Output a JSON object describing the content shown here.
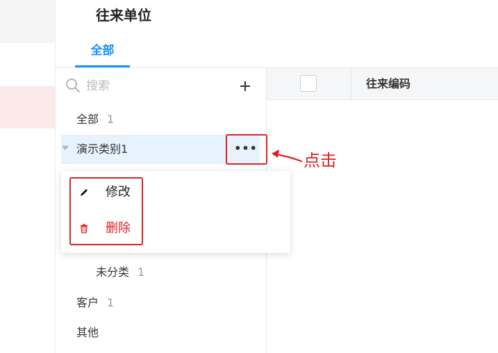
{
  "header": {
    "title": "往来单位",
    "tabs": [
      {
        "label": "全部",
        "active": true
      }
    ]
  },
  "category_panel": {
    "search_placeholder": "搜索",
    "add_icon": "plus-icon",
    "items": [
      {
        "label": "全部",
        "count": "1"
      },
      {
        "label": "演示类别1",
        "count": "",
        "selected": true,
        "expanded": true
      },
      {
        "label": "未分类",
        "count": "1"
      },
      {
        "label": "客户",
        "count": "1"
      },
      {
        "label": "其他",
        "count": ""
      }
    ],
    "more_button_label": "•••"
  },
  "context_menu": {
    "items": [
      {
        "label": "修改",
        "icon": "pencil-icon"
      },
      {
        "label": "删除",
        "icon": "trash-icon",
        "color": "#e02424"
      }
    ]
  },
  "table": {
    "columns": [
      "往来编码"
    ]
  },
  "annotation": {
    "text": "点击",
    "color": "#e02020"
  },
  "colors": {
    "accent": "#1890ff",
    "selected_row": "#e6f2fc",
    "danger": "#e02424"
  }
}
